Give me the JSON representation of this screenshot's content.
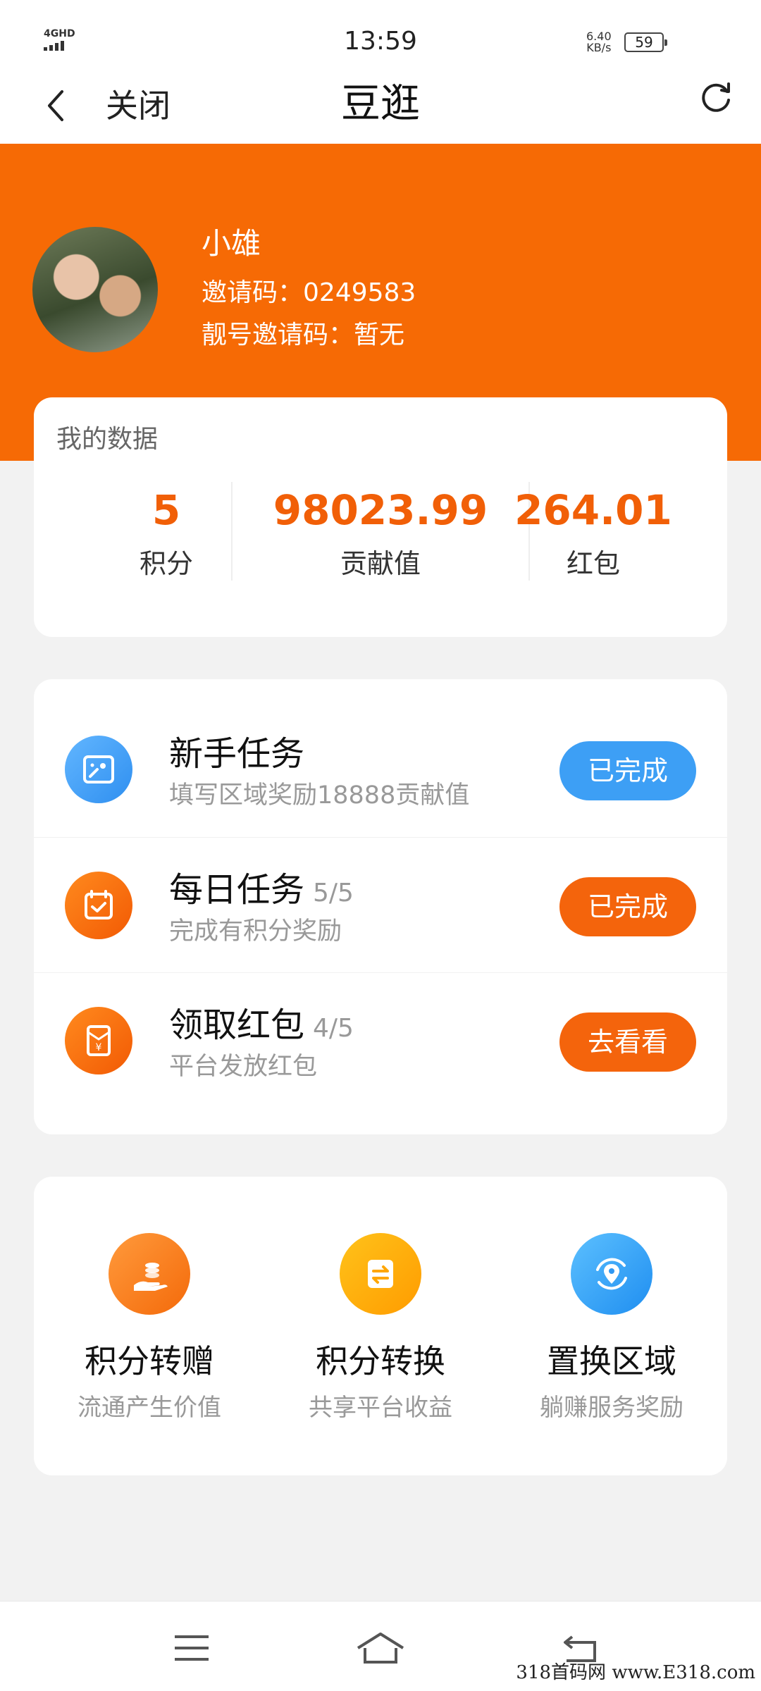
{
  "status_bar": {
    "network": "4GHD",
    "time": "13:59",
    "speed_value": "6.40",
    "speed_unit": "KB/s",
    "battery": "59"
  },
  "nav": {
    "close_label": "关闭",
    "title": "豆逛"
  },
  "profile": {
    "name": "小雄",
    "invite_code": "邀请码：0249583",
    "vip_invite_code": "靓号邀请码：暂无"
  },
  "stats": {
    "title": "我的数据",
    "items": [
      {
        "value": "5",
        "label": "积分"
      },
      {
        "value": "98023.99",
        "label": "贡献值"
      },
      {
        "value": "264.01",
        "label": "红包"
      }
    ]
  },
  "tasks": [
    {
      "title": "新手任务",
      "count": "",
      "subtitle": "填写区域奖励18888贡献值",
      "button": "已完成",
      "icon": "id-card-icon",
      "color": "#3d9ff5"
    },
    {
      "title": "每日任务",
      "count": "5/5",
      "subtitle": "完成有积分奖励",
      "button": "已完成",
      "icon": "calendar-check-icon",
      "color": "#f4640c"
    },
    {
      "title": "领取红包",
      "count": "4/5",
      "subtitle": "平台发放红包",
      "button": "去看看",
      "icon": "red-envelope-icon",
      "color": "#f4640c"
    }
  ],
  "actions": [
    {
      "title": "积分转赠",
      "subtitle": "流通产生价值",
      "icon": "coins-hand-icon"
    },
    {
      "title": "积分转换",
      "subtitle": "共享平台收益",
      "icon": "exchange-icon"
    },
    {
      "title": "置换区域",
      "subtitle": "躺赚服务奖励",
      "icon": "location-swap-icon"
    }
  ],
  "watermark": "318首码网 www.E318.com",
  "colors": {
    "brand_orange": "#f66a05",
    "accent_blue": "#3d9ff5",
    "stat_orange": "#f15f07"
  }
}
